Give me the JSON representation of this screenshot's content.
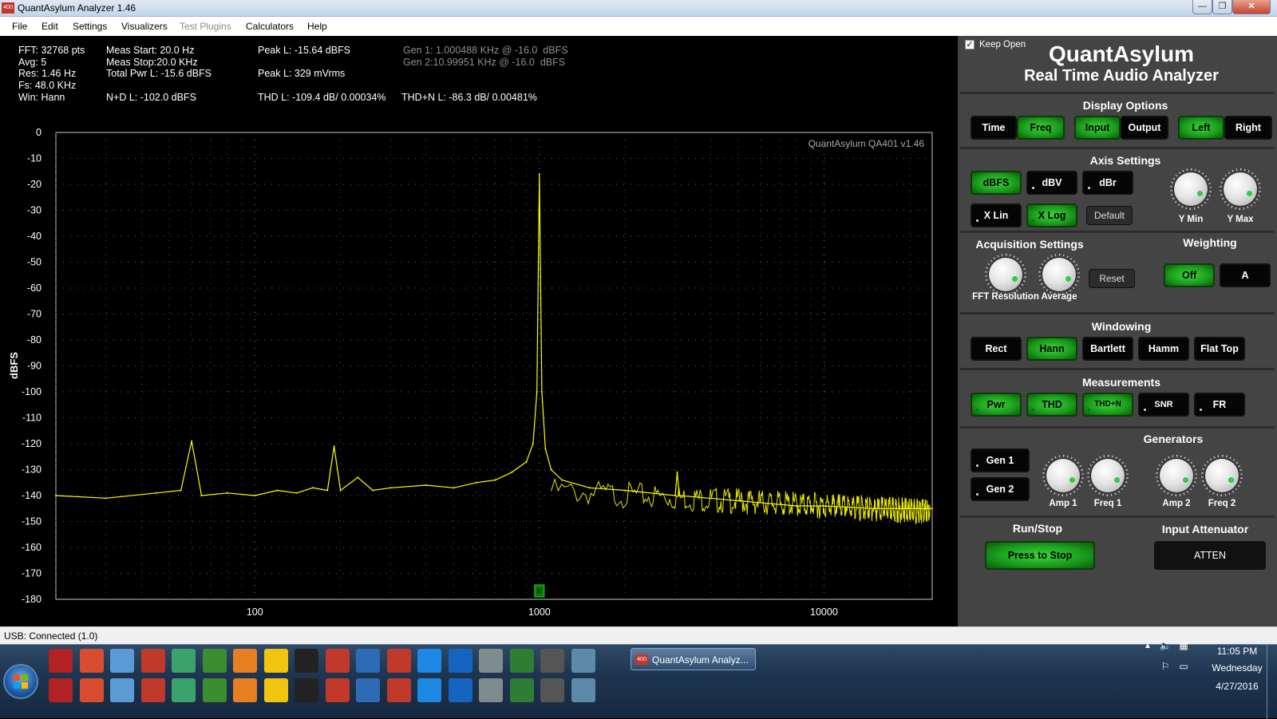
{
  "window": {
    "title": "QuantAsylum Analyzer 1.46",
    "icon_text": "400"
  },
  "menu": [
    "File",
    "Edit",
    "Settings",
    "Visualizers",
    "Test Plugins",
    "Calculators",
    "Help"
  ],
  "stats": {
    "fft": "FFT: 32768 pts",
    "avg": "Avg: 5",
    "res": "Res: 1.46 Hz",
    "fs": "Fs: 48.0 KHz",
    "win": "Win: Hann",
    "meas_start": "Meas Start: 20.0 Hz",
    "meas_stop": "Meas Stop:20.0 KHz",
    "total_pwr": "Total Pwr L: -15.6 dBFS",
    "nd": "N+D L: -102.0 dBFS",
    "peak_l": "Peak L: -15.64 dBFS",
    "peak_l2": "Peak L: 329 mVrms",
    "thd": "THD L: -109.4 dB/ 0.00034%",
    "thdn": "THD+N L: -86.3 dB/ 0.00481%",
    "gen1": "Gen 1: 1.000488 KHz @ -16.0  dBFS",
    "gen2": "Gen 2:10.99951 KHz @ -16.0  dBFS"
  },
  "chart_data": {
    "type": "line",
    "watermark": "QuantAsylum QA401 v1.46",
    "ylabel": "dBFS",
    "xlabel": "",
    "x_scale": "log",
    "xlim": [
      20,
      24000
    ],
    "ylim": [
      -180,
      0
    ],
    "x_ticks": [
      "100",
      "1000",
      "10000"
    ],
    "y_ticks": [
      "0",
      "-10",
      "-20",
      "-30",
      "-40",
      "-50",
      "-60",
      "-70",
      "-80",
      "-90",
      "-100",
      "-110",
      "-120",
      "-130",
      "-140",
      "-150",
      "-160",
      "-170",
      "-180"
    ],
    "grid": true,
    "marker": "F",
    "series": [
      {
        "color": "#ffff00",
        "x": [
          20,
          30,
          45,
          55,
          60,
          65,
          80,
          100,
          120,
          140,
          160,
          180,
          190,
          200,
          230,
          260,
          300,
          400,
          500,
          600,
          700,
          800,
          900,
          950,
          980,
          1000,
          1020,
          1050,
          1100,
          1200,
          1500,
          2000,
          3000,
          3050,
          3100,
          5000,
          8000,
          10000,
          15000,
          20000,
          24000
        ],
        "y": [
          -140,
          -141,
          -139,
          -138,
          -119,
          -140,
          -139,
          -140,
          -138,
          -139,
          -137,
          -138,
          -121,
          -138,
          -133,
          -138,
          -137,
          -136,
          -137,
          -135,
          -134,
          -131,
          -127,
          -120,
          -100,
          -16,
          -100,
          -122,
          -130,
          -134,
          -137,
          -138,
          -140,
          -131,
          -140,
          -142,
          -144,
          -144,
          -145,
          -145,
          -145
        ]
      }
    ]
  },
  "panel": {
    "keep_open": "Keep Open",
    "brand": "QuantAsylum",
    "subtitle": "Real Time Audio Analyzer",
    "display_options": "Display Options",
    "btn_time": "Time",
    "btn_freq": "Freq",
    "btn_input": "Input",
    "btn_output": "Output",
    "btn_left": "Left",
    "btn_right": "Right",
    "axis_settings": "Axis Settings",
    "btn_dbfs": "dBFS",
    "btn_dbv": "dBV",
    "btn_dbr": "dBr",
    "btn_xlin": "X Lin",
    "btn_xlog": "X Log",
    "btn_default": "Default",
    "ymin": "Y Min",
    "ymax": "Y Max",
    "acquisition": "Acquisition Settings",
    "fft_res": "FFT Resolution",
    "average": "Average",
    "btn_reset": "Reset",
    "weighting": "Weighting",
    "btn_off": "Off",
    "btn_a": "A",
    "windowing": "Windowing",
    "btn_rect": "Rect",
    "btn_hann": "Hann",
    "btn_bartlett": "Bartlett",
    "btn_hamm": "Hamm",
    "btn_flattop": "Flat Top",
    "measurements": "Measurements",
    "btn_pwr": "Pwr",
    "btn_thd": "THD",
    "btn_thdn": "THD+N",
    "btn_snr": "SNR",
    "btn_fr": "FR",
    "generators": "Generators",
    "btn_gen1": "Gen 1",
    "btn_gen2": "Gen 2",
    "amp1": "Amp 1",
    "freq1": "Freq 1",
    "amp2": "Amp 2",
    "freq2": "Freq 2",
    "run_stop": "Run/Stop",
    "btn_press_stop": "Press to Stop",
    "input_atten": "Input Attenuator",
    "btn_atten": "ATTEN"
  },
  "status": {
    "text": "USB: Connected  (1.0)"
  },
  "taskbar": {
    "active_window": "QuantAsylum Analyz...",
    "time": "11:05 PM",
    "day": "Wednesday",
    "date": "4/27/2016",
    "icons_row1": [
      "acrobat-icon",
      "pdf-icon",
      "network-icon",
      "cpu64-icon",
      "tools-icon",
      "greenshot-icon",
      "rocket-icon",
      "duck-icon",
      "cmd-icon",
      "app-icon",
      "explorer-icon",
      "eagle-icon",
      "teamviewer-icon",
      "fc-icon",
      "doc-icon",
      "chrome-icon",
      "printer-icon",
      "calculator-icon"
    ],
    "icons_row2": [
      "wifi-icon",
      "splash-icon",
      "kindle-icon",
      "ie-icon",
      "ltspice-icon",
      "excel-icon",
      "outlook-icon",
      "viewer-icon",
      "word-icon",
      "calendar-icon",
      "game-icon",
      "remote-icon",
      "record-icon",
      "folder-icon",
      "winrar-icon",
      "camera-icon",
      "firefox-icon",
      "maps-icon"
    ]
  }
}
